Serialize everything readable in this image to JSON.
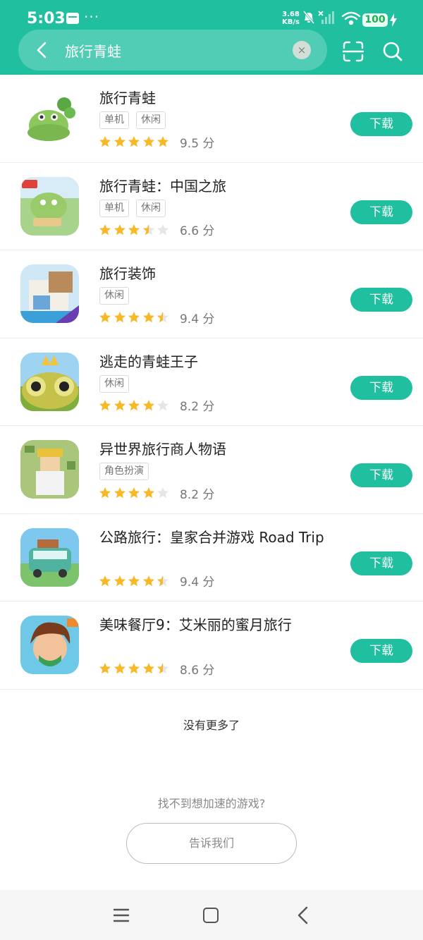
{
  "status_bar": {
    "time": "5:03",
    "dots": "···",
    "net_speed_value": "3.68",
    "net_speed_unit": "KB/s",
    "battery": "100"
  },
  "search": {
    "query": "旅行青蛙",
    "clear_symbol": "×"
  },
  "apps": [
    {
      "title": "旅行青蛙",
      "tags": [
        "单机",
        "休闲"
      ],
      "stars": 5,
      "score": "9.5 分",
      "button": "下载",
      "icon": "frog-icon"
    },
    {
      "title": "旅行青蛙：中国之旅",
      "tags": [
        "单机",
        "休闲"
      ],
      "stars": 3.5,
      "score": "6.6 分",
      "button": "下载",
      "icon": "frog-china-icon"
    },
    {
      "title": "旅行装饰",
      "tags": [
        "休闲"
      ],
      "stars": 4.5,
      "score": "9.4 分",
      "button": "下载",
      "icon": "house-icon"
    },
    {
      "title": "逃走的青蛙王子",
      "tags": [
        "休闲"
      ],
      "stars": 4,
      "score": "8.2 分",
      "button": "下载",
      "icon": "frog-prince-icon"
    },
    {
      "title": "异世界旅行商人物语",
      "tags": [
        "角色扮演"
      ],
      "stars": 4,
      "score": "8.2 分",
      "button": "下载",
      "icon": "pixel-girl-icon"
    },
    {
      "title": "公路旅行：皇家合并游戏 Road Trip",
      "tags": [],
      "stars": 4.5,
      "score": "9.4 分",
      "button": "下载",
      "icon": "van-icon"
    },
    {
      "title": "美味餐厅9：艾米丽的蜜月旅行",
      "tags": [],
      "stars": 4.5,
      "score": "8.6 分",
      "button": "下载",
      "icon": "emily-icon"
    }
  ],
  "footer": {
    "no_more": "没有更多了",
    "cant_find": "找不到想加速的游戏?",
    "tell_us": "告诉我们"
  },
  "colors": {
    "accent": "#1fbf9f",
    "star": "#f7b928",
    "star_empty": "#e6e6e6"
  }
}
